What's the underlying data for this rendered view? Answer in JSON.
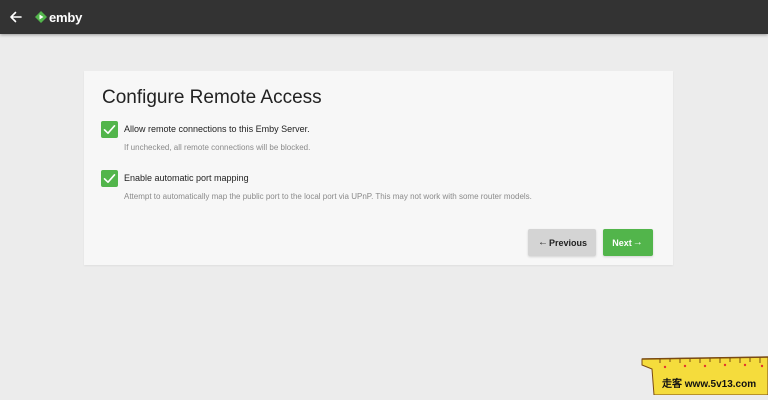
{
  "header": {
    "back_icon": "back-arrow-icon",
    "brand": "emby",
    "brand_color": "#52b54b"
  },
  "page": {
    "title": "Configure Remote Access"
  },
  "options": [
    {
      "label": "Allow remote connections to this Emby Server.",
      "description": "If unchecked, all remote connections will be blocked.",
      "checked": true
    },
    {
      "label": "Enable automatic port mapping",
      "description": "Attempt to automatically map the public port to the local port via UPnP. This may not work with some router models.",
      "checked": true
    }
  ],
  "buttons": {
    "previous_label": "Previous",
    "next_label": "Next"
  },
  "watermark": {
    "text": "走客 www.5v13.com"
  },
  "colors": {
    "accent": "#52b54b",
    "topbar": "#333333",
    "background": "#ececec",
    "card": "#f7f7f7"
  }
}
